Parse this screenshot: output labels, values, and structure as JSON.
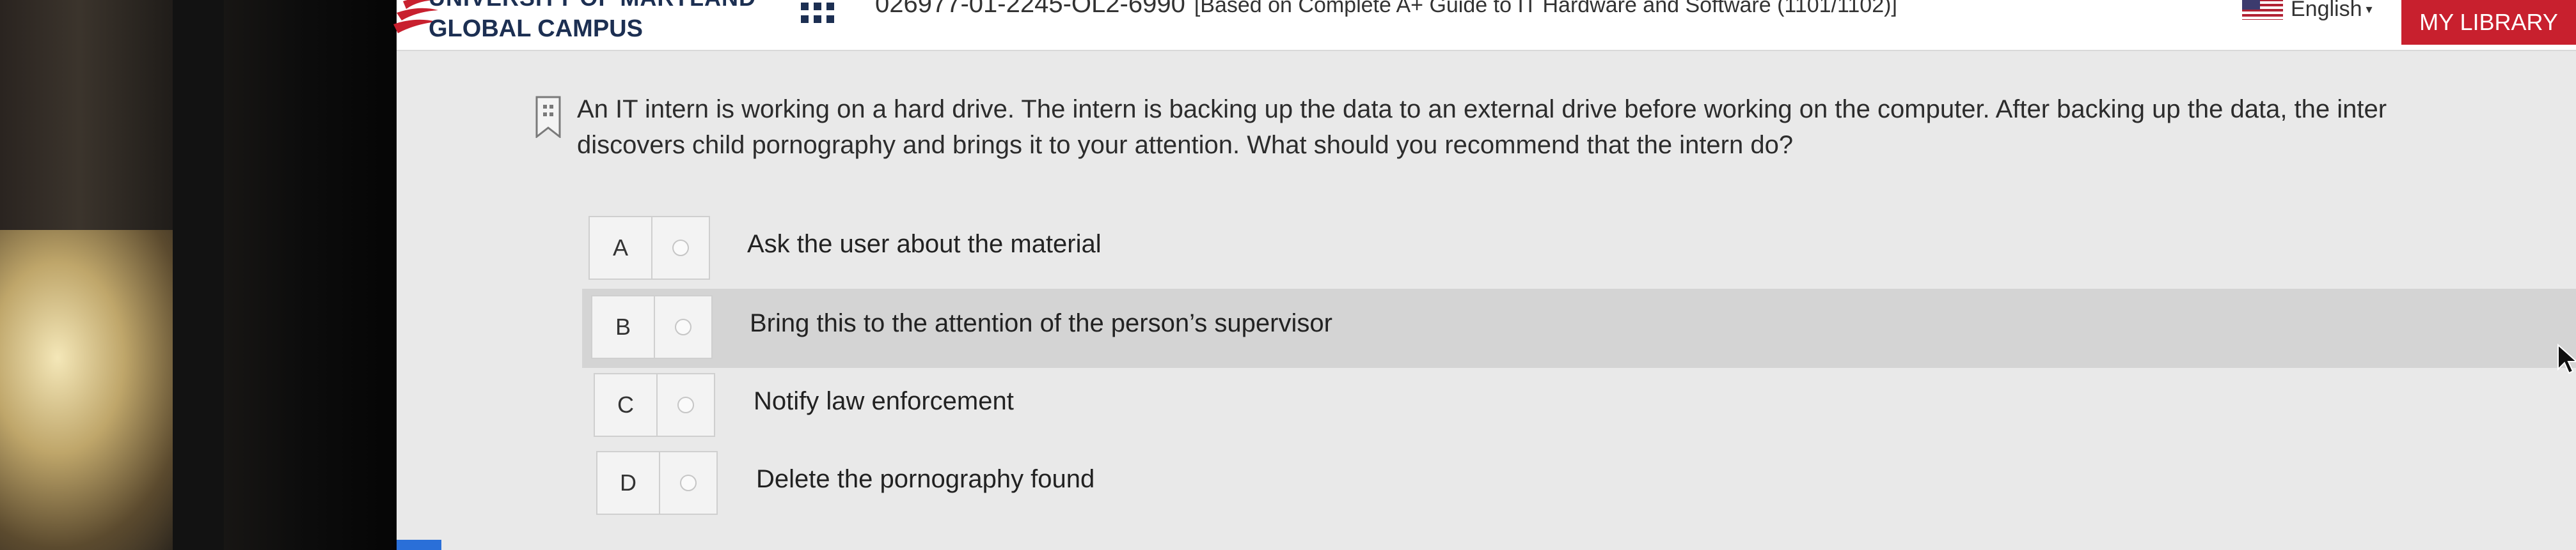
{
  "header": {
    "logo_top": "UNIVERSITY OF MARYLAND",
    "logo_bottom": "GLOBAL CAMPUS",
    "course_code": "026977-01-2245-OL2-6990",
    "course_title": "[Based on Complete A+ Guide to IT Hardware and Software (1101/1102)]",
    "language": "English",
    "my_library": "MY LIBRARY"
  },
  "question": {
    "line1": "An IT intern is working on a hard drive. The intern is backing up the data to an external drive before working on the computer. After backing up the data, the inter",
    "line2": "discovers child pornography and brings it to your attention. What should you recommend that the intern do?"
  },
  "options": [
    {
      "letter": "A",
      "text": "Ask the user about the material"
    },
    {
      "letter": "B",
      "text": "Bring this to the attention of the person’s supervisor"
    },
    {
      "letter": "C",
      "text": "Notify law enforcement"
    },
    {
      "letter": "D",
      "text": "Delete the pornography found"
    }
  ],
  "colors": {
    "brand_navy": "#1c2f52",
    "brand_red": "#c8202e",
    "hover_row": "#d4d4d4"
  },
  "icons": [
    "grid-icon",
    "flag-icon",
    "chevron-down-icon",
    "bookmark-icon",
    "radio-icon",
    "mouse-pointer-icon"
  ]
}
